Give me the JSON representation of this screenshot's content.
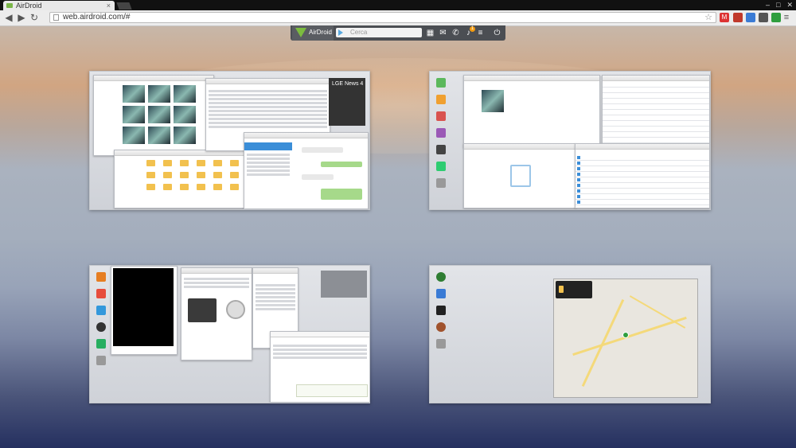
{
  "browser": {
    "tab_title": "AirDroid",
    "url": "web.airdroid.com/#",
    "window_controls": [
      "–",
      "□",
      "✕"
    ]
  },
  "airdroid_bar": {
    "logo_text": "AirDroid",
    "search_placeholder": "Cerca",
    "notification_count": "1",
    "icons": [
      "apps-grid-icon",
      "mail-icon",
      "phone-icon",
      "bell-icon",
      "menu-icon",
      "power-icon"
    ]
  },
  "workspaces": {
    "ws1": {
      "news_widget_title": "LGE News 4"
    }
  },
  "colors": {
    "airdroid_green": "#7cbc3f",
    "accent_blue": "#3b8ed8",
    "folder_yellow": "#f2c14e"
  }
}
